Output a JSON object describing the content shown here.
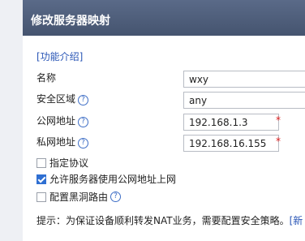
{
  "dialog": {
    "title": "修改服务器映射",
    "intro_link": "[功能介绍]"
  },
  "form": {
    "name": {
      "label": "名称",
      "value": "wxy"
    },
    "zone": {
      "label": "安全区域",
      "value": "any"
    },
    "public_addr": {
      "label": "公网地址",
      "value": "192.168.1.3",
      "required": "*"
    },
    "private_addr": {
      "label": "私网地址",
      "value": "192.168.16.155",
      "required": "*"
    }
  },
  "options": {
    "protocol": {
      "label": "指定协议",
      "checked": false
    },
    "allow_public": {
      "label": "允许服务器使用公网地址上网",
      "checked": true
    },
    "blackhole": {
      "label": "配置黑洞路由",
      "checked": false
    }
  },
  "hint": {
    "text": "提示：为保证设备顺利转发NAT业务，需要配置安全策略。",
    "link": "[新"
  },
  "help_glyph": "?"
}
